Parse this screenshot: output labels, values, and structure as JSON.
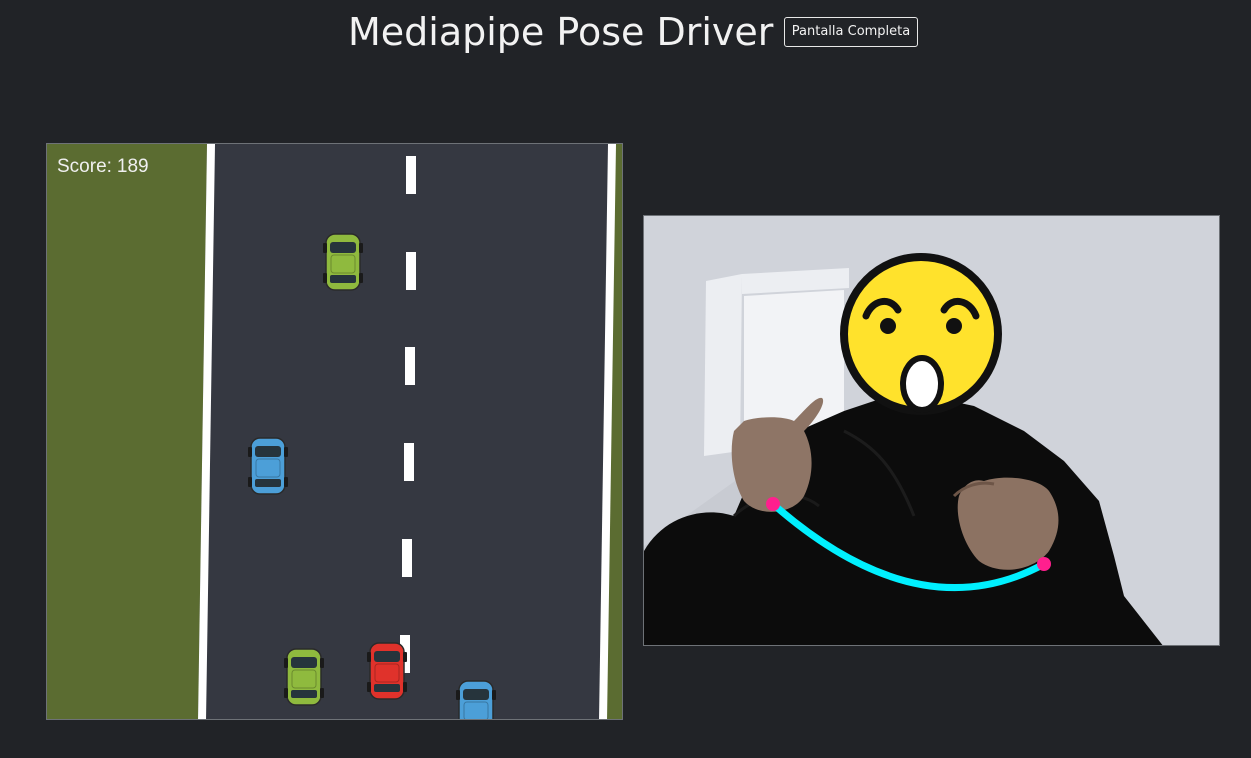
{
  "header": {
    "title": "Mediapipe Pose Driver",
    "fullscreen_label": "Pantalla Completa"
  },
  "game": {
    "score_label": "Score:",
    "score_value": "189",
    "player_car": {
      "color": "red",
      "icon": "red-car-icon"
    },
    "traffic_cars": [
      {
        "color": "green",
        "icon": "green-car-icon"
      },
      {
        "color": "blue",
        "icon": "blue-car-icon"
      },
      {
        "color": "green",
        "icon": "green-car-icon"
      },
      {
        "color": "blue",
        "icon": "blue-car-icon"
      }
    ],
    "colors": {
      "grass": "#5b6c31",
      "road": "#353841",
      "lane_marking": "#ffffff"
    }
  },
  "camera": {
    "face_overlay": "astonished-face-emoji-icon",
    "steering_arc_color": "#00f0ff",
    "hand_marker_color": "#ff1f8e"
  }
}
